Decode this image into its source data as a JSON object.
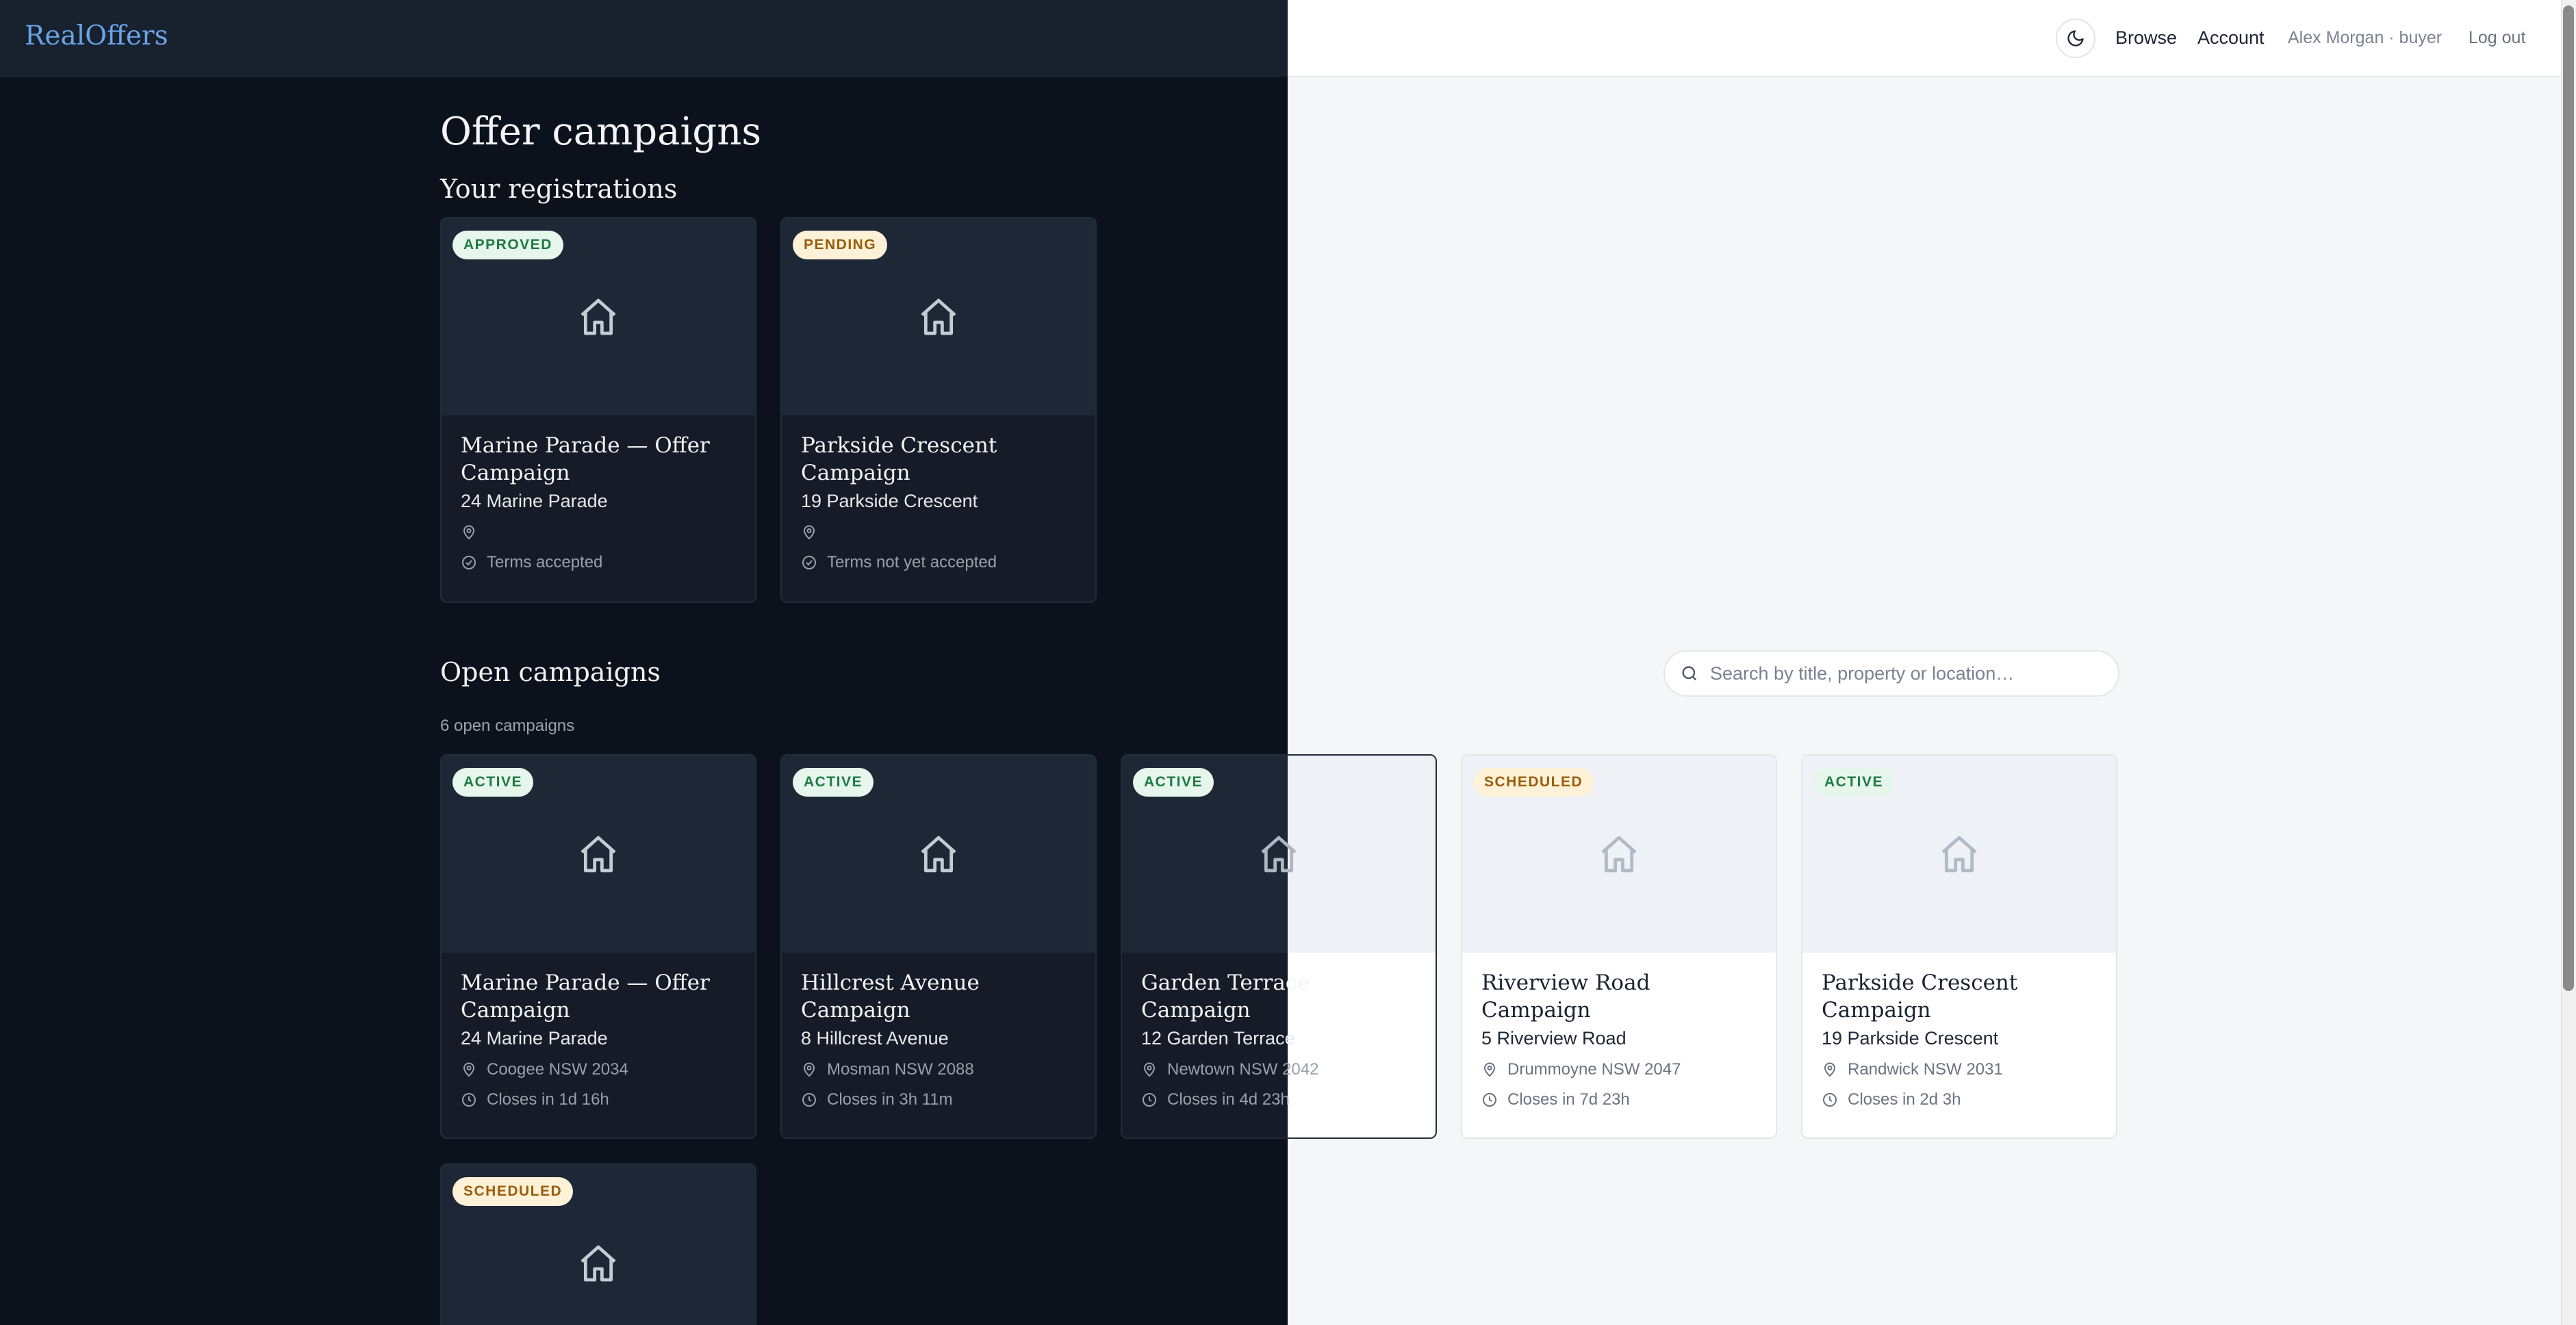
{
  "header": {
    "logo": "RealOffers",
    "nav": {
      "browse": "Browse",
      "account": "Account",
      "user": "Alex Morgan · buyer",
      "logout": "Log out"
    }
  },
  "page": {
    "title": "Offer campaigns",
    "registrations_heading": "Your registrations",
    "open_heading": "Open campaigns",
    "open_count": "6 open campaigns"
  },
  "search": {
    "placeholder": "Search by title, property or location…"
  },
  "registrations": [
    {
      "status": "APPROVED",
      "title": "Marine Parade — Offer Campaign",
      "address": "24 Marine Parade",
      "location": "",
      "terms": "Terms accepted"
    },
    {
      "status": "PENDING",
      "title": "Parkside Crescent Campaign",
      "address": "19 Parkside Crescent",
      "location": "",
      "terms": "Terms not yet accepted"
    }
  ],
  "campaigns": [
    {
      "status": "ACTIVE",
      "title": "Marine Parade — Offer Campaign",
      "address": "24 Marine Parade",
      "location": "Coogee NSW 2034",
      "closes": "Closes in 1d 16h"
    },
    {
      "status": "ACTIVE",
      "title": "Hillcrest Avenue Campaign",
      "address": "8 Hillcrest Avenue",
      "location": "Mosman NSW 2088",
      "closes": "Closes in 3h 11m"
    },
    {
      "status": "ACTIVE",
      "title": "Garden Terrace Campaign",
      "address": "12 Garden Terrace",
      "location": "Newtown NSW 2042",
      "closes": "Closes in 4d 23h"
    },
    {
      "status": "SCHEDULED",
      "title": "Riverview Road Campaign",
      "address": "5 Riverview Road",
      "location": "Drummoyne NSW 2047",
      "closes": "Closes in 7d 23h"
    },
    {
      "status": "ACTIVE",
      "title": "Parkside Crescent Campaign",
      "address": "19 Parkside Crescent",
      "location": "Randwick NSW 2031",
      "closes": "Closes in 2d 3h"
    },
    {
      "status": "SCHEDULED"
    }
  ],
  "icons": {
    "theme": "moon-icon",
    "search": "search-icon",
    "thumb": "house-icon",
    "location": "map-pin-icon",
    "terms": "check-circle-icon",
    "closes": "clock-icon"
  },
  "colors": {
    "accent": "#6aa3e8",
    "approved": "#1e7a43",
    "pending": "#9a5d0b"
  }
}
